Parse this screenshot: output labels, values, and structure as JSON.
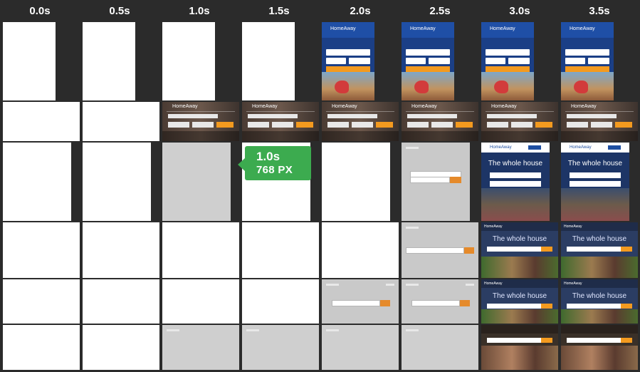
{
  "timeline": {
    "labels": [
      "0.0s",
      "0.5s",
      "1.0s",
      "1.5s",
      "2.0s",
      "2.5s",
      "3.0s",
      "3.5s"
    ]
  },
  "callout": {
    "time": "1.0s",
    "width": "768 PX"
  },
  "brand": {
    "logo_text": "HomeAway",
    "tablet_headline": "The whole house",
    "accent_color": "#f39a1f",
    "callout_color": "#3cab4f",
    "brand_blue": "#1e4fa1"
  },
  "frames": {
    "row1": [
      "blank",
      "blank",
      "blank",
      "blank",
      "phone",
      "phone",
      "phone",
      "phone"
    ],
    "row2": [
      "blank",
      "blank",
      "banner",
      "banner",
      "banner",
      "banner",
      "banner",
      "banner"
    ],
    "row3": [
      "blank",
      "blank",
      "gray",
      "blank",
      "blank",
      "skeleton",
      "tablet",
      "tablet"
    ],
    "row4": [
      "blank",
      "blank",
      "blank",
      "blank",
      "blank",
      "skeleton",
      "desktop",
      "desktop"
    ],
    "row5": [
      "blank",
      "blank",
      "blank",
      "blank",
      "skeleton",
      "skeleton",
      "desktop",
      "desktop"
    ],
    "row6": [
      "blank",
      "blank",
      "gray",
      "gray",
      "gray",
      "gray",
      "desktop",
      "desktop"
    ]
  }
}
